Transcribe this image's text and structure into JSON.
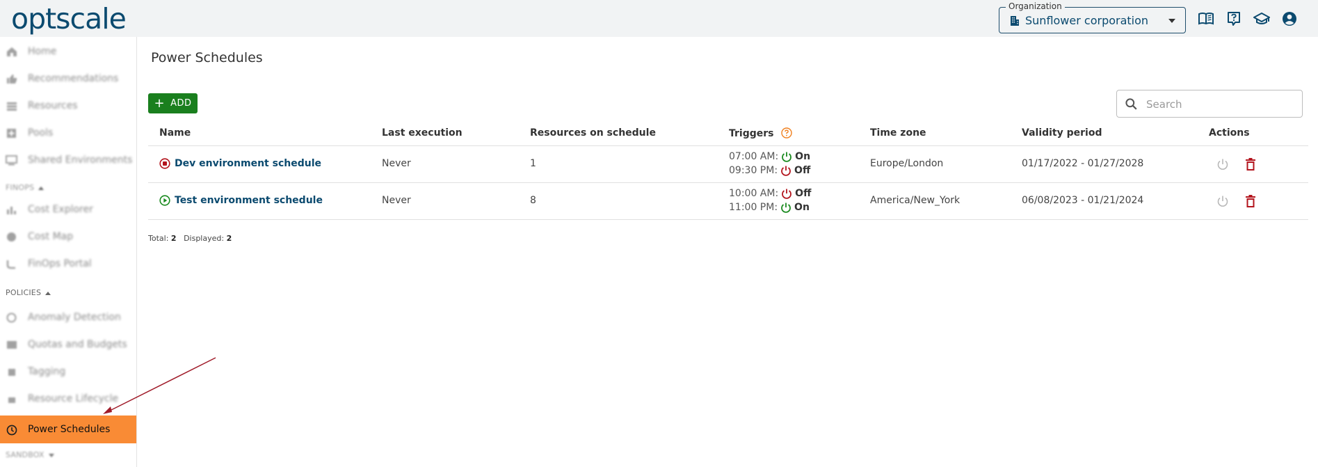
{
  "app": {
    "logo": "optscale"
  },
  "topbar": {
    "organization_label": "Organization",
    "organization_value": "Sunflower corporation",
    "icons": [
      "documentation-icon",
      "help-icon",
      "school-icon",
      "account-icon"
    ]
  },
  "sidebar": {
    "items_top": [
      {
        "label": "Home",
        "icon": "home-icon"
      },
      {
        "label": "Recommendations",
        "icon": "thumb-up-icon"
      },
      {
        "label": "Resources",
        "icon": "list-icon"
      },
      {
        "label": "Pools",
        "icon": "pool-icon"
      },
      {
        "label": "Shared Environments",
        "icon": "monitor-icon"
      }
    ],
    "section_finops": "FINOPS",
    "items_finops": [
      {
        "label": "Cost Explorer",
        "icon": "bar-chart-icon"
      },
      {
        "label": "Cost Map",
        "icon": "globe-icon"
      },
      {
        "label": "FinOps Portal",
        "icon": "portal-icon"
      }
    ],
    "section_policies": "POLICIES",
    "items_policies": [
      {
        "label": "Anomaly Detection",
        "icon": "anomaly-icon"
      },
      {
        "label": "Quotas and Budgets",
        "icon": "quota-icon"
      },
      {
        "label": "Tagging",
        "icon": "tag-icon"
      },
      {
        "label": "Resource Lifecycle",
        "icon": "lifecycle-icon"
      },
      {
        "label": "Power Schedules",
        "icon": "clock-icon",
        "active": true
      }
    ],
    "section_sandbox": "SANDBOX"
  },
  "main": {
    "title": "Power Schedules",
    "add_label": "ADD",
    "search_placeholder": "Search",
    "columns": [
      "Name",
      "Last execution",
      "Resources on schedule",
      "Triggers",
      "Time zone",
      "Validity period",
      "Actions"
    ],
    "rows": [
      {
        "name": "Dev environment schedule",
        "status": "stopped",
        "last_execution": "Never",
        "resources": "1",
        "triggers": [
          {
            "time": "07:00 AM:",
            "state": "On"
          },
          {
            "time": "09:30 PM:",
            "state": "Off"
          }
        ],
        "timezone": "Europe/London",
        "validity": "01/17/2022 - 01/27/2028"
      },
      {
        "name": "Test environment schedule",
        "status": "running",
        "last_execution": "Never",
        "resources": "8",
        "triggers": [
          {
            "time": "10:00 AM:",
            "state": "Off"
          },
          {
            "time": "11:00 PM:",
            "state": "On"
          }
        ],
        "timezone": "America/New_York",
        "validity": "06/08/2023 - 01/21/2024"
      }
    ],
    "totals_label": "Total:",
    "totals_value": "2",
    "displayed_label": "Displayed:",
    "displayed_value": "2"
  },
  "colors": {
    "brand": "#0b4a6f",
    "accent_active": "#f98b35",
    "add_button": "#1a7f1e",
    "power_on": "#1a8a1f",
    "power_off": "#b3141d",
    "help_orange": "#f0801f",
    "annotation_arrow": "#a01c2a"
  }
}
